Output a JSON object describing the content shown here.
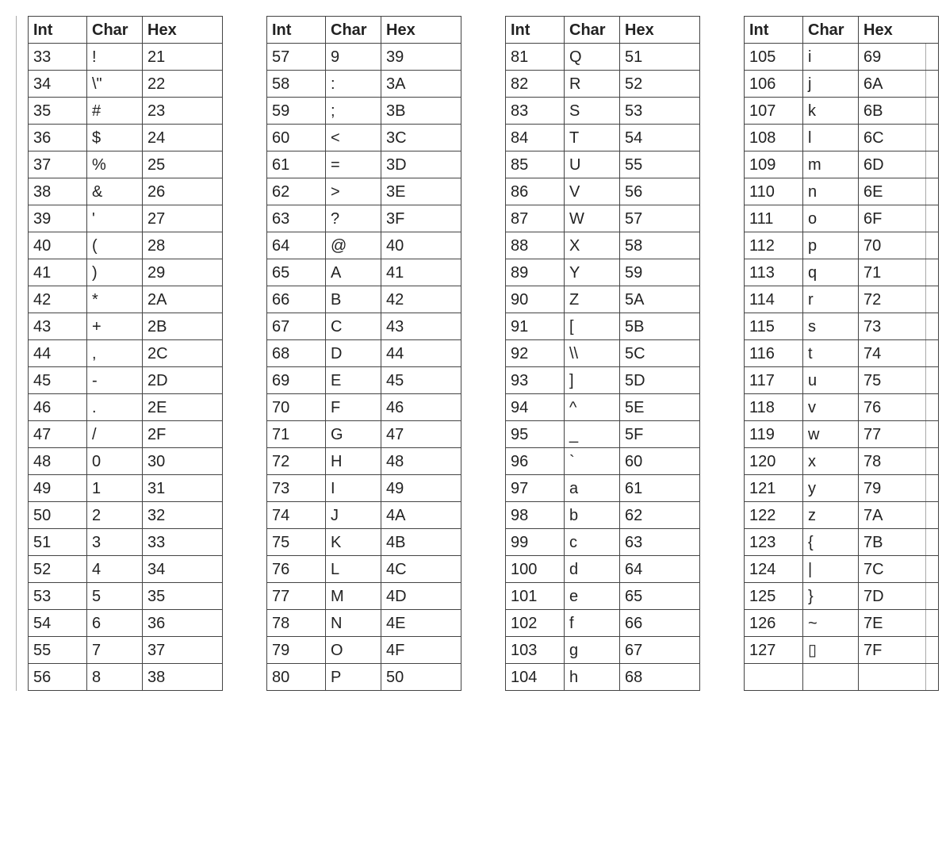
{
  "headers": {
    "int": "Int",
    "char": "Char",
    "hex": "Hex"
  },
  "tables": [
    [
      {
        "int": "33",
        "char": "!",
        "hex": "21"
      },
      {
        "int": "34",
        "char": "\\\"",
        "hex": "22"
      },
      {
        "int": "35",
        "char": "#",
        "hex": "23"
      },
      {
        "int": "36",
        "char": "$",
        "hex": "24"
      },
      {
        "int": "37",
        "char": "%",
        "hex": "25"
      },
      {
        "int": "38",
        "char": "&",
        "hex": "26"
      },
      {
        "int": "39",
        "char": "'",
        "hex": "27"
      },
      {
        "int": "40",
        "char": "(",
        "hex": "28"
      },
      {
        "int": "41",
        "char": ")",
        "hex": "29"
      },
      {
        "int": "42",
        "char": "*",
        "hex": "2A"
      },
      {
        "int": "43",
        "char": "+",
        "hex": "2B"
      },
      {
        "int": "44",
        "char": ",",
        "hex": "2C"
      },
      {
        "int": "45",
        "char": "-",
        "hex": "2D"
      },
      {
        "int": "46",
        "char": ".",
        "hex": "2E"
      },
      {
        "int": "47",
        "char": "/",
        "hex": "2F"
      },
      {
        "int": "48",
        "char": "0",
        "hex": "30"
      },
      {
        "int": "49",
        "char": "1",
        "hex": "31"
      },
      {
        "int": "50",
        "char": "2",
        "hex": "32"
      },
      {
        "int": "51",
        "char": "3",
        "hex": "33"
      },
      {
        "int": "52",
        "char": "4",
        "hex": "34"
      },
      {
        "int": "53",
        "char": "5",
        "hex": "35"
      },
      {
        "int": "54",
        "char": "6",
        "hex": "36"
      },
      {
        "int": "55",
        "char": "7",
        "hex": "37"
      },
      {
        "int": "56",
        "char": "8",
        "hex": "38"
      }
    ],
    [
      {
        "int": "57",
        "char": "9",
        "hex": "39"
      },
      {
        "int": "58",
        "char": ":",
        "hex": "3A"
      },
      {
        "int": "59",
        "char": ";",
        "hex": "3B"
      },
      {
        "int": "60",
        "char": "<",
        "hex": "3C"
      },
      {
        "int": "61",
        "char": "=",
        "hex": "3D"
      },
      {
        "int": "62",
        "char": ">",
        "hex": "3E"
      },
      {
        "int": "63",
        "char": "?",
        "hex": "3F"
      },
      {
        "int": "64",
        "char": "@",
        "hex": "40"
      },
      {
        "int": "65",
        "char": "A",
        "hex": "41"
      },
      {
        "int": "66",
        "char": "B",
        "hex": "42"
      },
      {
        "int": "67",
        "char": "C",
        "hex": "43"
      },
      {
        "int": "68",
        "char": "D",
        "hex": "44"
      },
      {
        "int": "69",
        "char": "E",
        "hex": "45"
      },
      {
        "int": "70",
        "char": "F",
        "hex": "46"
      },
      {
        "int": "71",
        "char": "G",
        "hex": "47"
      },
      {
        "int": "72",
        "char": "H",
        "hex": "48"
      },
      {
        "int": "73",
        "char": "I",
        "hex": "49"
      },
      {
        "int": "74",
        "char": "J",
        "hex": "4A"
      },
      {
        "int": "75",
        "char": "K",
        "hex": "4B"
      },
      {
        "int": "76",
        "char": "L",
        "hex": "4C"
      },
      {
        "int": "77",
        "char": "M",
        "hex": "4D"
      },
      {
        "int": "78",
        "char": "N",
        "hex": "4E"
      },
      {
        "int": "79",
        "char": "O",
        "hex": "4F"
      },
      {
        "int": "80",
        "char": "P",
        "hex": "50"
      }
    ],
    [
      {
        "int": "81",
        "char": "Q",
        "hex": "51"
      },
      {
        "int": "82",
        "char": "R",
        "hex": "52"
      },
      {
        "int": "83",
        "char": "S",
        "hex": "53"
      },
      {
        "int": "84",
        "char": "T",
        "hex": "54"
      },
      {
        "int": "85",
        "char": "U",
        "hex": "55"
      },
      {
        "int": "86",
        "char": "V",
        "hex": "56"
      },
      {
        "int": "87",
        "char": "W",
        "hex": "57"
      },
      {
        "int": "88",
        "char": "X",
        "hex": "58"
      },
      {
        "int": "89",
        "char": "Y",
        "hex": "59"
      },
      {
        "int": "90",
        "char": "Z",
        "hex": "5A"
      },
      {
        "int": "91",
        "char": "[",
        "hex": "5B"
      },
      {
        "int": "92",
        "char": "\\\\",
        "hex": "5C"
      },
      {
        "int": "93",
        "char": "]",
        "hex": "5D"
      },
      {
        "int": "94",
        "char": "^",
        "hex": "5E"
      },
      {
        "int": "95",
        "char": "_",
        "hex": "5F"
      },
      {
        "int": "96",
        "char": "`",
        "hex": "60"
      },
      {
        "int": "97",
        "char": "a",
        "hex": "61"
      },
      {
        "int": "98",
        "char": "b",
        "hex": "62"
      },
      {
        "int": "99",
        "char": "c",
        "hex": "63"
      },
      {
        "int": "100",
        "char": "d",
        "hex": "64"
      },
      {
        "int": "101",
        "char": "e",
        "hex": "65"
      },
      {
        "int": "102",
        "char": "f",
        "hex": "66"
      },
      {
        "int": "103",
        "char": "g",
        "hex": "67"
      },
      {
        "int": "104",
        "char": "h",
        "hex": "68"
      }
    ],
    [
      {
        "int": "105",
        "char": "i",
        "hex": "69"
      },
      {
        "int": "106",
        "char": "j",
        "hex": "6A"
      },
      {
        "int": "107",
        "char": "k",
        "hex": "6B"
      },
      {
        "int": "108",
        "char": "l",
        "hex": "6C"
      },
      {
        "int": "109",
        "char": "m",
        "hex": "6D"
      },
      {
        "int": "110",
        "char": "n",
        "hex": "6E"
      },
      {
        "int": "111",
        "char": "o",
        "hex": "6F"
      },
      {
        "int": "112",
        "char": "p",
        "hex": "70"
      },
      {
        "int": "113",
        "char": "q",
        "hex": "71"
      },
      {
        "int": "114",
        "char": "r",
        "hex": "72"
      },
      {
        "int": "115",
        "char": "s",
        "hex": "73"
      },
      {
        "int": "116",
        "char": "t",
        "hex": "74"
      },
      {
        "int": "117",
        "char": "u",
        "hex": "75"
      },
      {
        "int": "118",
        "char": "v",
        "hex": "76"
      },
      {
        "int": "119",
        "char": "w",
        "hex": "77"
      },
      {
        "int": "120",
        "char": "x",
        "hex": "78"
      },
      {
        "int": "121",
        "char": "y",
        "hex": "79"
      },
      {
        "int": "122",
        "char": "z",
        "hex": "7A"
      },
      {
        "int": "123",
        "char": "{",
        "hex": "7B"
      },
      {
        "int": "124",
        "char": "|",
        "hex": "7C"
      },
      {
        "int": "125",
        "char": "}",
        "hex": "7D"
      },
      {
        "int": "126",
        "char": "~",
        "hex": "7E"
      },
      {
        "int": "127",
        "char": "▯",
        "hex": "7F"
      },
      {
        "int": "",
        "char": "",
        "hex": ""
      }
    ]
  ]
}
